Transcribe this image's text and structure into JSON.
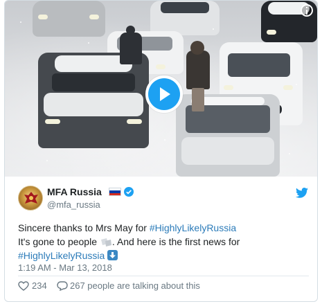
{
  "video": {
    "play_icon": "play-icon",
    "info_icon": "info-icon"
  },
  "author": {
    "name": "MFA Russia",
    "handle": "@mfa_russia",
    "flag_colors": [
      "#ffffff",
      "#0039a6",
      "#d52b1e"
    ],
    "verified_icon": "verified-badge-icon"
  },
  "tweet": {
    "line1_prefix": "Sincere thanks to Mrs May for ",
    "line1_hashtag": "#HighlyLikelyRussia",
    "line2_text": "It's gone to people ",
    "line2_suffix": ". And here is the first news for",
    "line3_hashtag": "#HighlyLikelyRussia",
    "timestamp": "1:19 AM - Mar 13, 2018"
  },
  "actions": {
    "likes": "234",
    "talking": "267 people are talking about this"
  },
  "colors": {
    "link": "#2b7bb9",
    "accent": "#1da1f2",
    "muted": "#697882"
  }
}
